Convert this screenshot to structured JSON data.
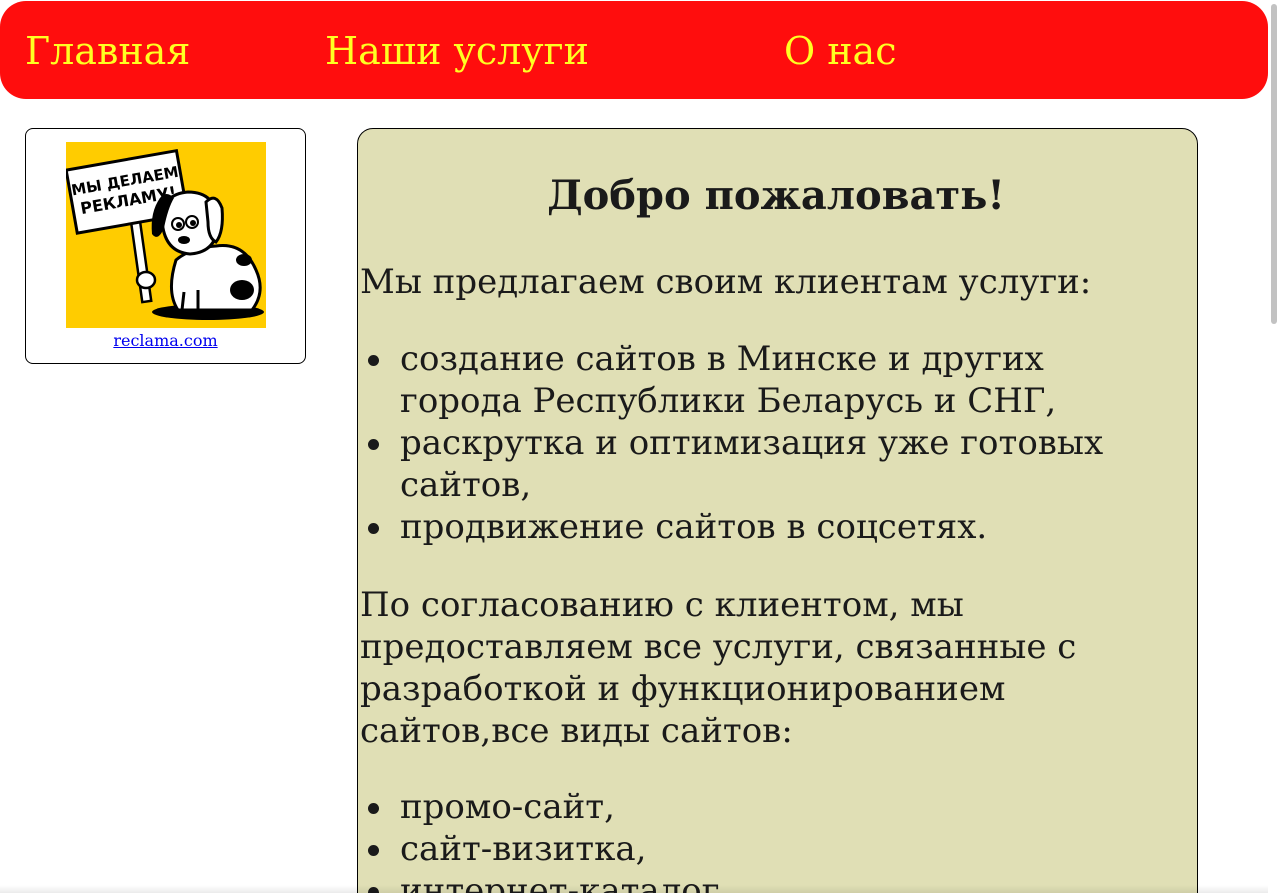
{
  "nav": {
    "home": "Главная",
    "services": "Наши услуги",
    "about": "О нас",
    "bg_color": "#ff0d0d",
    "text_color": "#ffff22"
  },
  "ad": {
    "sign_text": "МЫ ДЕЛАЕМ РЕКЛАМУ!",
    "link_text": "reclama.com",
    "bg_color": "#ffcc00"
  },
  "content": {
    "bg_color": "#e0dfb5",
    "title": "Добро пожаловать!",
    "intro": "Мы предлагаем своим клиентам услуги:",
    "services": [
      "создание сайтов в Минске и других города Республики Беларусь и СНГ,",
      "раскрутка и оптимизация уже готовых сайтов,",
      "продвижение сайтов в соцсетях."
    ],
    "detail": "По согласованию с клиентом, мы предоставляем все услуги, связанные с разработкой и функционированием сайтов,все виды сайтов:",
    "site_types": [
      "промо-сайт,",
      "сайт-визитка,",
      "интернет-каталог"
    ]
  }
}
